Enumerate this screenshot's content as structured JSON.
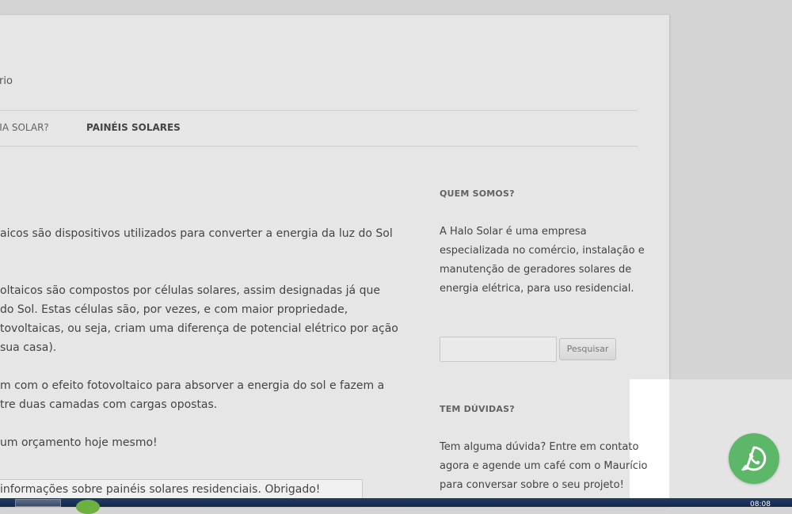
{
  "header": {
    "tagline": "rio"
  },
  "nav": {
    "items": [
      {
        "label": "GIA SOLAR?"
      },
      {
        "label": "PAINÉIS SOLARES"
      }
    ]
  },
  "content": {
    "paragraphs": [
      "aicos são dispositivos utilizados para converter a energia da luz do Sol",
      "oltaicos são compostos por células solares, assim designadas já que",
      "do Sol. Estas células são, por vezes, e com maior propriedade,",
      "tovoltaicas, ou seja, criam uma diferença de potencial elétrico por ação",
      "sua casa).",
      "m com o efeito fotovoltaico para absorver a energia do sol e fazem a",
      "tre duas camadas com cargas opostas.",
      "um orçamento hoje mesmo!"
    ],
    "message_field_value": "informações sobre painéis solares residenciais. Obrigado!"
  },
  "sidebar": {
    "about": {
      "title": "QUEM SOMOS?",
      "lines": [
        "A Halo Solar é uma empresa",
        "especializada no comércio, instalação e",
        "manutenção de geradores solares de",
        "energia elétrica, para uso residencial."
      ]
    },
    "search": {
      "button_label": "Pesquisar",
      "value": ""
    },
    "contact": {
      "title": "TEM DÚVIDAS?",
      "lines": [
        "Tem alguma dúvida? Entre em contato",
        "agora e agende um café com o Maurício",
        "para conversar sobre o seu projeto!"
      ]
    }
  },
  "widgets": {
    "whatsapp_icon": "whatsapp-icon"
  },
  "taskbar": {
    "clock": "08:08"
  },
  "colors": {
    "whatsapp_green": "#5cb768",
    "page_bg": "#e6e6e6",
    "outer_bg": "#d4d4d4"
  }
}
